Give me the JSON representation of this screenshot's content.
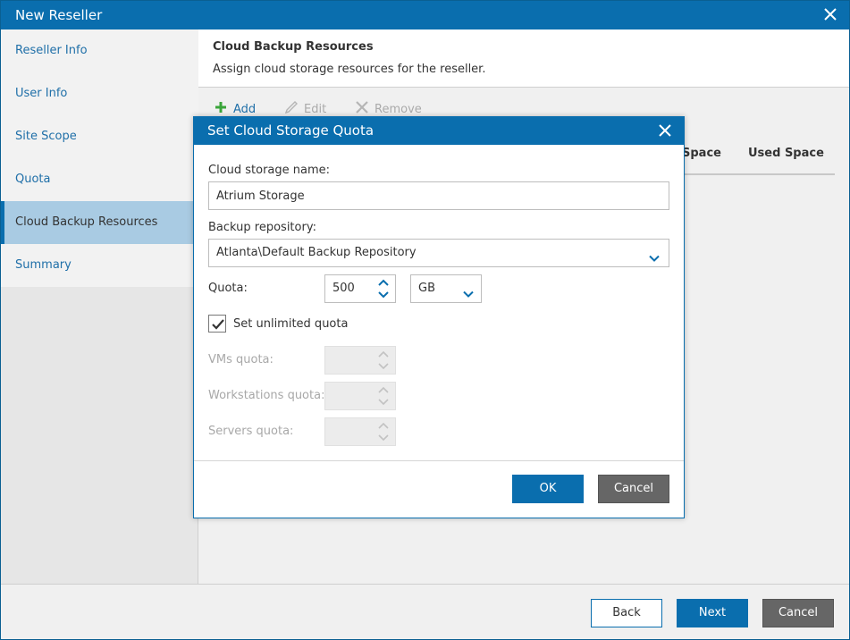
{
  "window": {
    "title": "New Reseller"
  },
  "sidebar": {
    "items": [
      {
        "label": "Reseller Info"
      },
      {
        "label": "User Info"
      },
      {
        "label": "Site Scope"
      },
      {
        "label": "Quota"
      },
      {
        "label": "Cloud Backup Resources"
      },
      {
        "label": "Summary"
      }
    ],
    "active_index": 4
  },
  "content": {
    "title": "Cloud Backup Resources",
    "subtitle": "Assign cloud storage resources for the reseller.",
    "toolbar": {
      "add_label": "Add",
      "edit_label": "Edit",
      "remove_label": "Remove"
    },
    "table": {
      "columns": [
        "Space",
        "Used Space"
      ]
    }
  },
  "footer": {
    "back_label": "Back",
    "next_label": "Next",
    "cancel_label": "Cancel"
  },
  "dialog": {
    "title": "Set Cloud Storage Quota",
    "storage_name_label": "Cloud storage name:",
    "storage_name_value": "Atrium Storage",
    "repository_label": "Backup repository:",
    "repository_value": "Atlanta\\Default Backup Repository",
    "quota_label": "Quota:",
    "quota_value": "500",
    "quota_unit": "GB",
    "unlimited_label": "Set unlimited quota",
    "unlimited_checked": true,
    "vms_quota_label": "VMs quota:",
    "workstations_quota_label": "Workstations quota:",
    "servers_quota_label": "Servers quota:",
    "ok_label": "OK",
    "cancel_label": "Cancel"
  },
  "colors": {
    "accent": "#0a6eae",
    "sidebar_active": "#a9cbe3",
    "add_icon": "#3aa53a"
  }
}
